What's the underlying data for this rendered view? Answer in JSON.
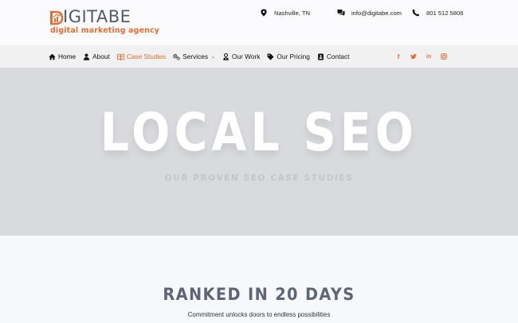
{
  "header": {
    "logo_word": "IGITABE",
    "logo_tagline": "digital marketing agency",
    "location": "Nashville, TN",
    "email": "info@digitabe.com",
    "phone": "801 512 5806"
  },
  "nav": {
    "items": [
      {
        "label": "Home",
        "icon": "home-icon"
      },
      {
        "label": "About",
        "icon": "user-icon"
      },
      {
        "label": "Case Studies",
        "icon": "book-icon",
        "active": true
      },
      {
        "label": "Services",
        "icon": "gears-icon",
        "dropdown": true
      },
      {
        "label": "Our Work",
        "icon": "user-tie-icon"
      },
      {
        "label": "Our Pricing",
        "icon": "tag-icon"
      },
      {
        "label": "Contact",
        "icon": "address-card-icon"
      }
    ],
    "socials": [
      {
        "name": "facebook-icon",
        "glyph": "f"
      },
      {
        "name": "twitter-icon",
        "glyph": "t"
      },
      {
        "name": "linkedin-icon",
        "glyph": "in"
      },
      {
        "name": "instagram-icon",
        "glyph": "◎"
      }
    ]
  },
  "hero": {
    "title": "LOCAL SEO",
    "subtitle": "OUR PROVEN SEO CASE STUDIES"
  },
  "section": {
    "title": "RANKED IN 20 DAYS",
    "subtitle": "Commitment unlocks doors to endless possibilities"
  },
  "colors": {
    "accent": "#e26d35",
    "hero_bg": "#d9dadd",
    "heading": "#5e6576"
  }
}
